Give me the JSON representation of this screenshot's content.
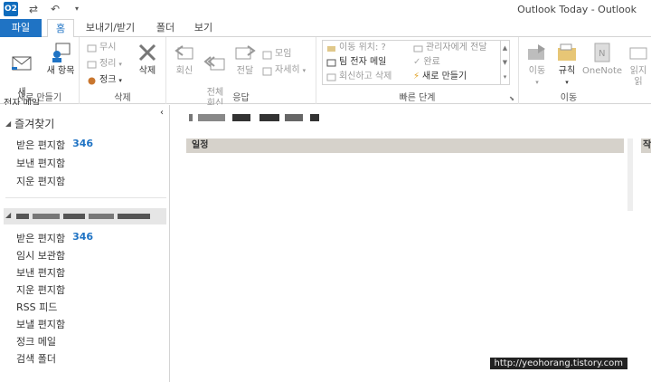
{
  "window": {
    "title": "Outlook Today - Outlook",
    "app_icon": "O2"
  },
  "qat": {
    "send_receive_icon": "send-receive-icon",
    "undo_icon": "undo-icon",
    "dropdown_icon": "chevron-down-icon"
  },
  "tabs": [
    {
      "label": "파일"
    },
    {
      "label": "홈"
    },
    {
      "label": "보내기/받기"
    },
    {
      "label": "폴더"
    },
    {
      "label": "보기"
    }
  ],
  "ribbon": {
    "new": {
      "label": "새로 만들기",
      "new_mail": "새\n전자 메일",
      "new_items": "새 항목"
    },
    "delete": {
      "label": "삭제",
      "ignore": "무시",
      "cleanup": "정리",
      "junk": "정크",
      "delete": "삭제"
    },
    "respond": {
      "label": "응답",
      "reply": "회신",
      "reply_all": "전체\n회신",
      "forward": "전달",
      "meeting": "모임",
      "more": "자세히"
    },
    "quick_steps": {
      "label": "빠른 단계",
      "items": [
        "이동 위치: ?",
        "관리자에게 전달",
        "팀 전자 메일",
        "완료",
        "회신하고 삭제",
        "새로 만들기"
      ]
    },
    "move": {
      "label": "이동",
      "move": "이동",
      "rules": "규칙",
      "onenote": "OneNote",
      "read": "읽지",
      "read2": "읽"
    }
  },
  "nav": {
    "favorites_header": "즐겨찾기",
    "favorites": [
      {
        "label": "받은 편지함",
        "count": "346"
      },
      {
        "label": "보낸 편지함",
        "count": ""
      },
      {
        "label": "지운 편지함",
        "count": ""
      }
    ],
    "account_folders": [
      {
        "label": "받은 편지함",
        "count": "346"
      },
      {
        "label": "임시 보관함",
        "count": ""
      },
      {
        "label": "보낸 편지함",
        "count": ""
      },
      {
        "label": "지운 편지함",
        "count": ""
      },
      {
        "label": "RSS 피드",
        "count": ""
      },
      {
        "label": "보낼 편지함",
        "count": ""
      },
      {
        "label": "정크 메일",
        "count": ""
      },
      {
        "label": "검색 폴더",
        "count": ""
      }
    ]
  },
  "main": {
    "calendar_header": "일정",
    "next_col_header": "작"
  },
  "watermark": "http://yeohorang.tistory.com",
  "colors": {
    "accent": "#1f73c4",
    "column_header": "#d6d2cb"
  }
}
